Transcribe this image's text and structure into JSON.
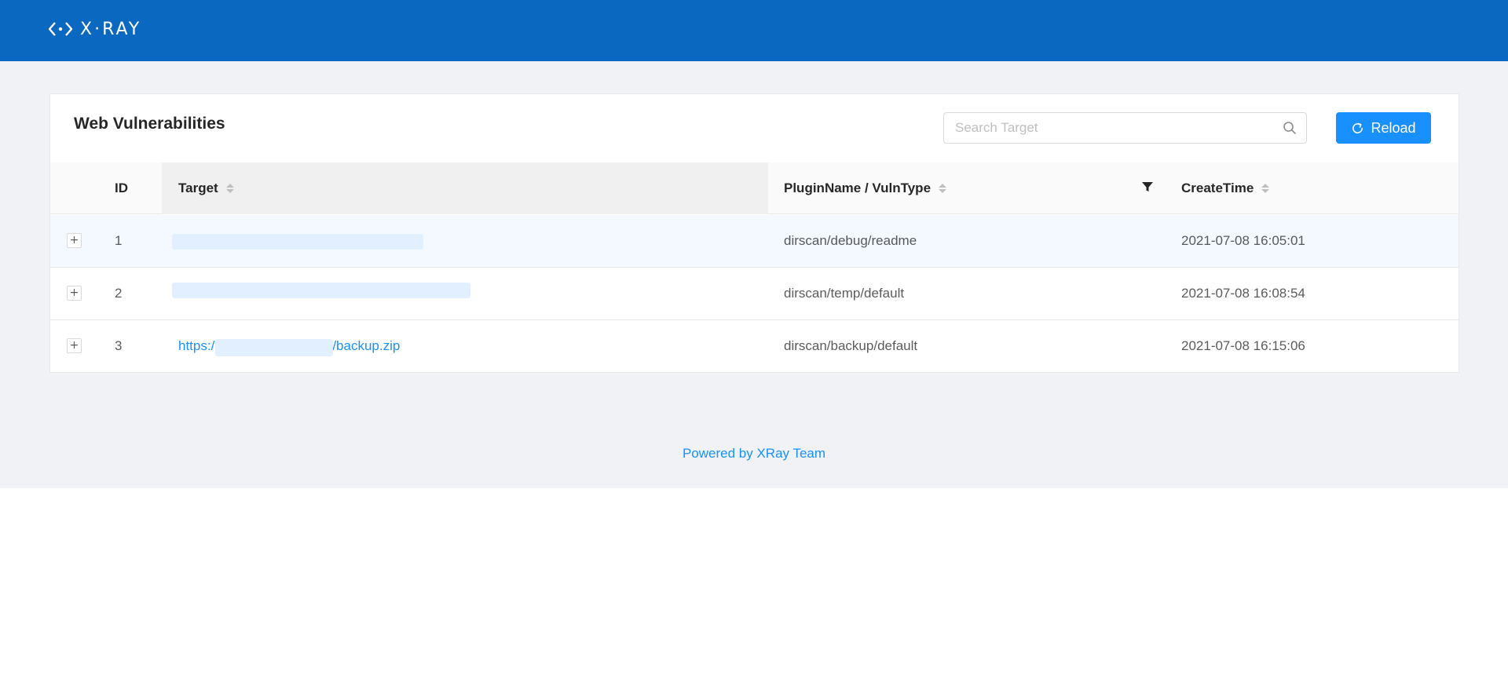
{
  "header": {
    "logo_text": "X·RAY",
    "logo_icon": "xray-logo-icon",
    "background": "#0a68c1"
  },
  "card": {
    "title": "Web Vulnerabilities",
    "search": {
      "placeholder": "Search Target",
      "value": "",
      "icon": "search-icon"
    },
    "reload": {
      "label": "Reload",
      "icon": "reload-icon",
      "color": "#1890ff"
    }
  },
  "table": {
    "columns": [
      {
        "key": "id",
        "label": "ID",
        "sortable": false
      },
      {
        "key": "target",
        "label": "Target",
        "sortable": true
      },
      {
        "key": "plugin",
        "label": "PluginName / VulnType",
        "sortable": true,
        "filterable": true
      },
      {
        "key": "time",
        "label": "CreateTime",
        "sortable": true
      }
    ],
    "rows": [
      {
        "expand": "+",
        "id": "1",
        "target_prefix": "",
        "target_suffix": "",
        "plugin": "dirscan/debug/readme",
        "time": "2021-07-08 16:05:01",
        "target_redacted": true
      },
      {
        "expand": "+",
        "id": "2",
        "target_prefix": "",
        "target_suffix": "",
        "plugin": "dirscan/temp/default",
        "time": "2021-07-08 16:08:54",
        "target_redacted": true
      },
      {
        "expand": "+",
        "id": "3",
        "target_prefix": "https:/",
        "target_suffix": "/backup.zip",
        "plugin": "dirscan/backup/default",
        "time": "2021-07-08 16:15:06",
        "target_redacted": true
      }
    ]
  },
  "footer": {
    "text": "Powered by XRay Team"
  }
}
